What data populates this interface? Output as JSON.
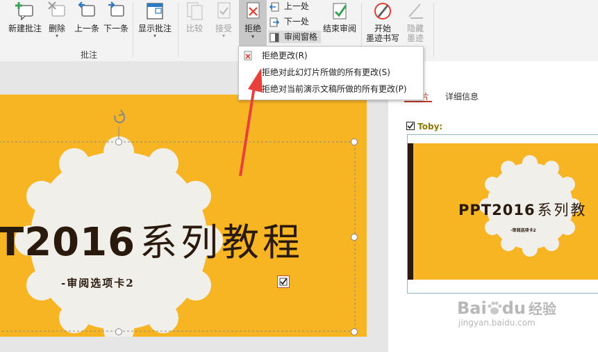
{
  "ribbon": {
    "buttons": {
      "new_comment": "新建批注",
      "delete": "删除",
      "previous": "上一条",
      "next": "下一条",
      "show_comments": "显示批注",
      "compare": "比较",
      "accept": "接受",
      "reject": "拒绝",
      "prev_change": "上一处",
      "next_change": "下一处",
      "review_pane": "审阅窗格",
      "end_review": "结束审阅",
      "start_ink_line1": "开始",
      "start_ink_line2": "墨迹书写",
      "hide_ink_line1": "隐藏",
      "hide_ink_line2": "墨迹"
    },
    "group_comments_label": "批注"
  },
  "reject_menu": {
    "items": [
      "拒绝更改(R)",
      "拒绝对此幻灯片所做的所有更改(S)",
      "拒绝对当前演示文稿所做的所有更改(P)"
    ]
  },
  "slide": {
    "title_part1": "T2016",
    "title_part2": "系列教程",
    "subtitle": "-审阅选项卡2"
  },
  "review_pane": {
    "tabs": [
      "幻灯片",
      "详细信息"
    ],
    "author": "Toby:",
    "thumb_title_part1": "PPT2016",
    "thumb_title_part2": "系列教",
    "thumb_subtitle": "-审阅选项卡2"
  },
  "watermark": {
    "brand": "Bai",
    "brand2": "du",
    "brand_cn": "经验",
    "url": "jingyan.baidu.com"
  },
  "colors": {
    "slide_bg": "#f7b423",
    "arrow": "#e8413b",
    "accent_green": "#3aa352"
  }
}
